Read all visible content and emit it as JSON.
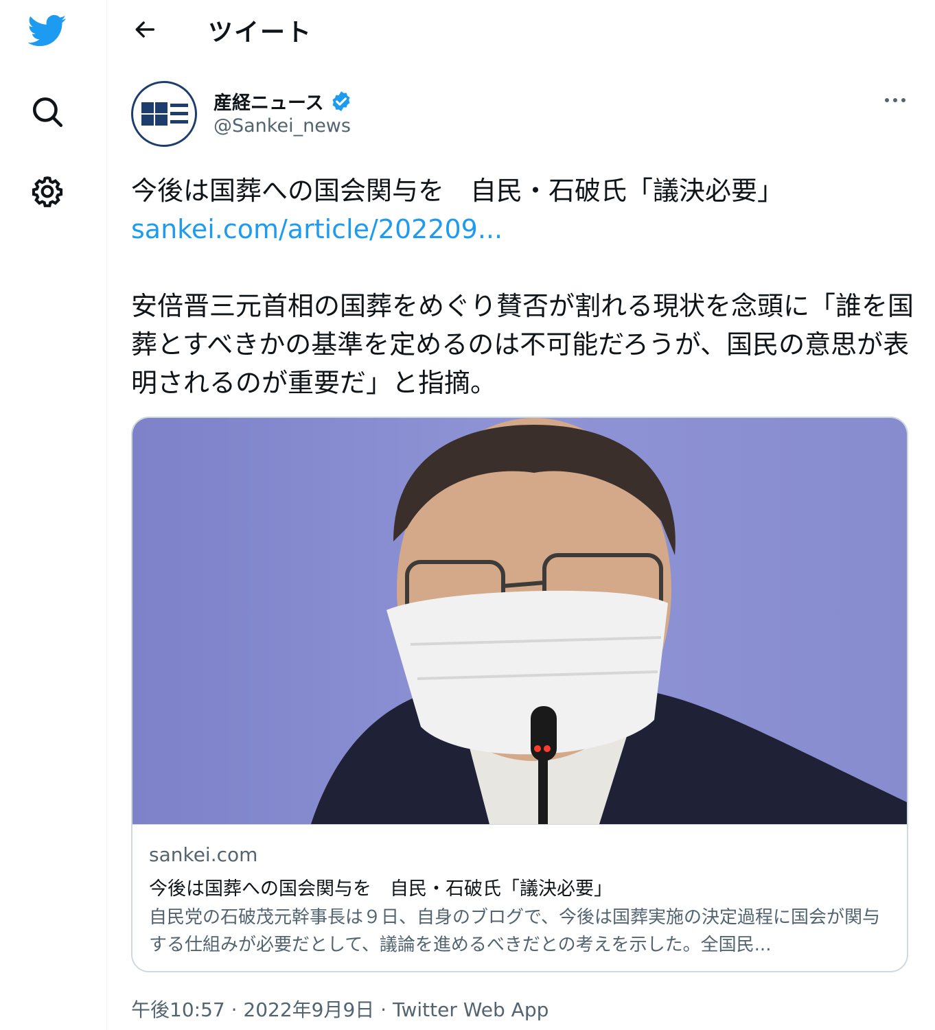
{
  "sidebar": {
    "items": [
      {
        "icon": "twitter-bird-icon"
      },
      {
        "icon": "search-icon"
      },
      {
        "icon": "gear-icon"
      }
    ]
  },
  "header": {
    "title": "ツイート"
  },
  "tweet": {
    "author_name": "産経ニュース",
    "author_handle": "@Sankei_news",
    "headline": "今後は国葬への国会関与を　自民・石破氏「議決必要」",
    "link": "sankei.com/article/202209...",
    "body": "安倍晋三元首相の国葬をめぐり賛否が割れる現状を念頭に「誰を国葬とすべきかの基準を定めるのは不可能だろうが、国民の意思が表明されるのが重要だ」と指摘。",
    "timestamp": "午後10:57 · 2022年9月9日 · Twitter Web App"
  },
  "card": {
    "domain": "sankei.com",
    "title": "今後は国葬への国会関与を　自民・石破氏「議決必要」",
    "description": "自民党の石破茂元幹事長は９日、自身のブログで、今後は国葬実施の決定過程に国会が関与する仕組みが必要だとして、議論を進めるべきだとの考えを示した。全国民..."
  },
  "colors": {
    "accent": "#1d9bf0",
    "muted": "#536471",
    "border": "#cfd9de"
  }
}
